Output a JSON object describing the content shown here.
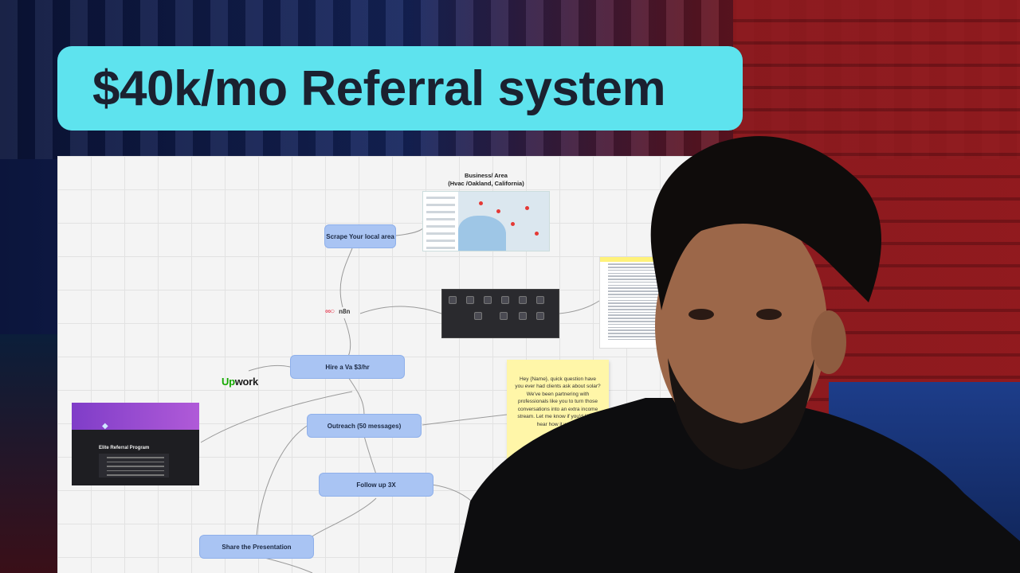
{
  "title": "$40k/mo Referral system",
  "flow": {
    "area_label_line1": "Business/ Area",
    "area_label_line2": "(Hvac /Oakland, California)",
    "nodes": {
      "scrape": "Scrape Your local area",
      "hire": "Hire a Va $3/hr",
      "outreach": "Outreach (50 messages)",
      "follow_up": "Follow up 3X",
      "share": "Share the Presentation"
    },
    "n8n_label": "n8n",
    "upwork_label_green": "Up",
    "upwork_label_dark": "work",
    "sticky_note": "Hey {Name}, quick question have you ever had clients ask about solar? We've been partnering with professionals like you to turn those conversations into an extra income stream. Let me know if you'd like to hear how it works!",
    "elite_title": "Elite Referral Program"
  },
  "icons": {
    "n8n": "n8n-logo-icon",
    "gem": "gem-icon"
  },
  "colors": {
    "banner": "#5ee3ee",
    "node": "#a9c4f3",
    "sticky": "#fff6a8",
    "upwork_green": "#14a800"
  }
}
